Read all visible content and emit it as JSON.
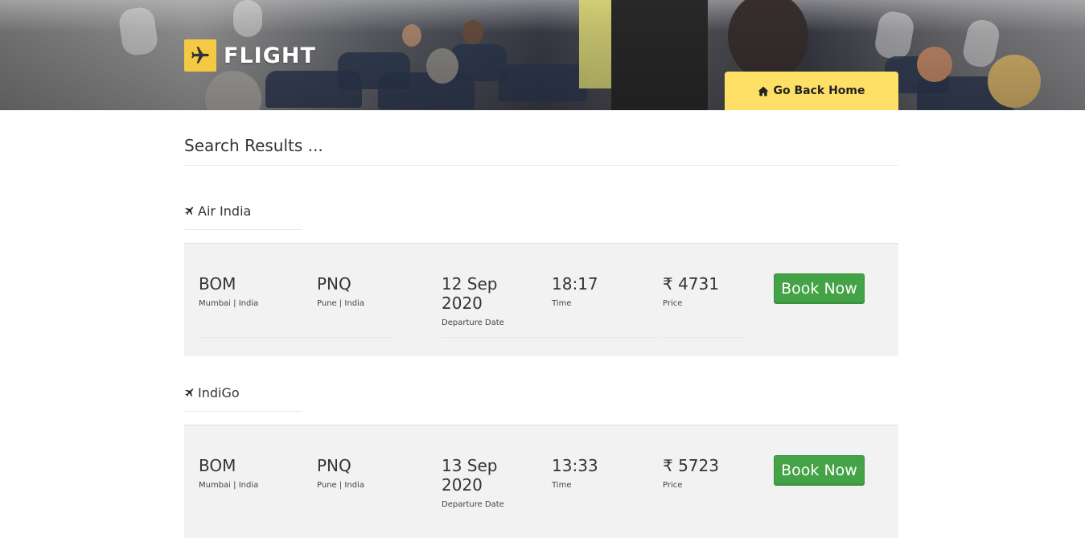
{
  "brand": {
    "name": "FLIGHT"
  },
  "header": {
    "home_button_label": "Go Back Home"
  },
  "page": {
    "title": "Search Results ..."
  },
  "flights": [
    {
      "airline": "Air India",
      "origin_code": "BOM",
      "origin_city": "Mumbai | India",
      "dest_code": "PNQ",
      "dest_city": "Pune | India",
      "date_line1": "12 Sep",
      "date_line2": "2020",
      "date_label": "Departure Date",
      "time": "18:17",
      "time_label": "Time",
      "price": "₹ 4731",
      "price_label": "Price",
      "book_label": "Book Now"
    },
    {
      "airline": "IndiGo",
      "origin_code": "BOM",
      "origin_city": "Mumbai | India",
      "dest_code": "PNQ",
      "dest_city": "Pune | India",
      "date_line1": "13 Sep",
      "date_line2": "2020",
      "date_label": "Departure Date",
      "time": "13:33",
      "time_label": "Time",
      "price": "₹ 5723",
      "price_label": "Price",
      "book_label": "Book Now"
    }
  ],
  "colors": {
    "accent_yellow": "#ffe066",
    "logo_yellow": "#f6c945",
    "book_green": "#44a247",
    "card_bg": "#f2f2f2"
  },
  "icons": {
    "logo": "airplane-icon",
    "home": "home-icon",
    "airline": "airplane-icon"
  }
}
